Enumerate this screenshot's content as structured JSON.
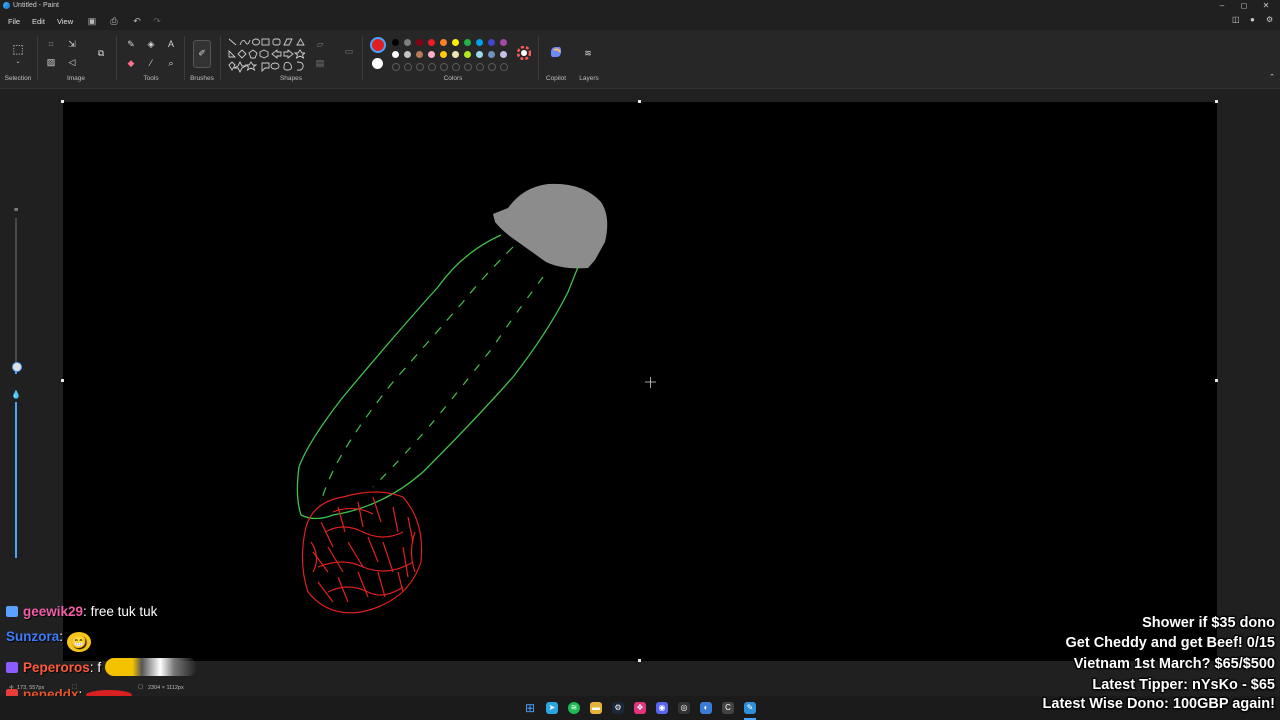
{
  "window": {
    "title": "Untitled - Paint",
    "controls": [
      "–",
      "◻",
      "✕"
    ]
  },
  "menu": {
    "items": [
      "File",
      "Edit",
      "View"
    ]
  },
  "ribbon": {
    "groups": [
      "Selection",
      "Image",
      "Tools",
      "Brushes",
      "Shapes",
      "Colors",
      "Copilot",
      "Layers"
    ],
    "accent": "#4aa3ff",
    "primary_color": "#e02020",
    "secondary_color": "#ffffff",
    "palette": [
      "#000000",
      "#7f7f7f",
      "#880015",
      "#ed1c24",
      "#ff7f27",
      "#fff200",
      "#22b14c",
      "#00a2e8",
      "#3f48cc",
      "#a349a4",
      "#ffffff",
      "#c3c3c3",
      "#b97a57",
      "#ffaec9",
      "#ffc90e",
      "#efe4b0",
      "#b5e61d",
      "#99d9ea",
      "#7092be",
      "#c8bfe7"
    ]
  },
  "canvas": {
    "background": "#000000"
  },
  "chat": [
    {
      "user": "geewik29",
      "sep": ":",
      "message": "free tuk tuk",
      "color": "#f25ea8",
      "badge_color": "#5aa0ff"
    },
    {
      "user": "Sunzora",
      "sep": ":",
      "message": "",
      "color": "#3d7bff",
      "emote": "😁"
    },
    {
      "user": "Peperoros",
      "sep": ":",
      "message": "f",
      "color": "#ff5a3d",
      "badge_color": "#8a5cff"
    },
    {
      "user": "pepeddx",
      "sep": ":",
      "message": "",
      "color": "#e8542b",
      "badge_color": "#e83b3b"
    }
  ],
  "overlay": {
    "lines": [
      "Shower if $35 dono",
      "Get Cheddy and get Beef! 0/15",
      "Vietnam 1st March? $65/$500",
      "Latest Tipper: nYsKo - $65",
      "Latest Wise Dono: 100GBP again!"
    ]
  },
  "status": {
    "cursor_pos": "173, 557px",
    "canvas_size": "2304 × 1112px"
  }
}
